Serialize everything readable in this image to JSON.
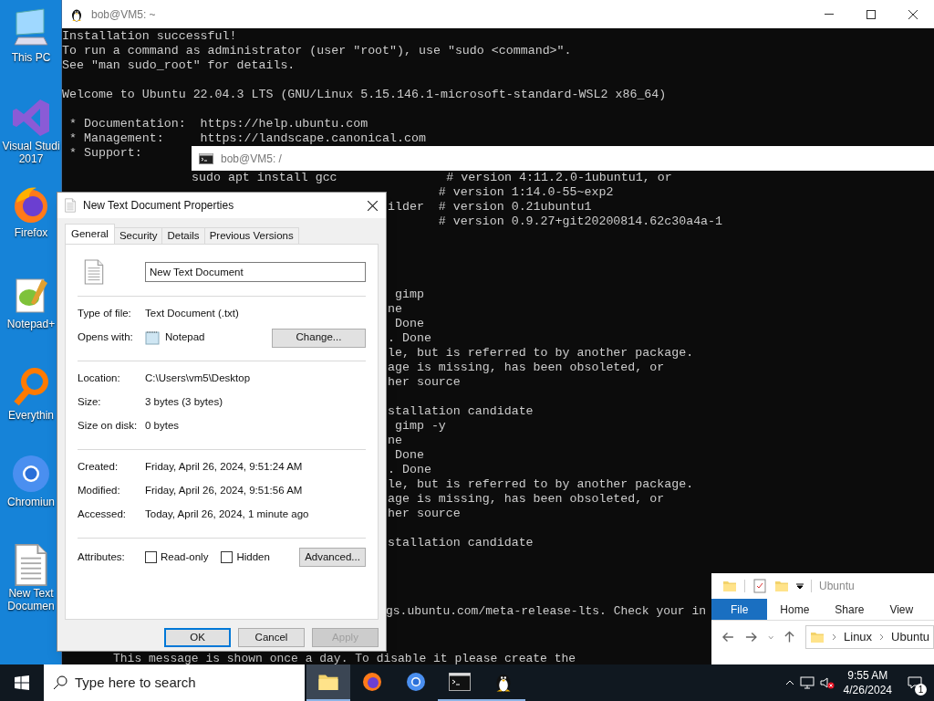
{
  "desktop_icons": [
    {
      "kind": "computer",
      "label": [
        "This PC"
      ]
    },
    {
      "kind": "studio",
      "label": [
        "Visual Studi",
        "2017"
      ]
    },
    {
      "kind": "firefox",
      "label": [
        "Firefox"
      ]
    },
    {
      "kind": "notepad",
      "label": [
        "Notepad+"
      ]
    },
    {
      "kind": "search",
      "label": [
        "Everythin"
      ]
    },
    {
      "kind": "chromium",
      "label": [
        "Chromiun"
      ]
    },
    {
      "kind": "textfile",
      "label": [
        "New Text",
        "Documen"
      ]
    }
  ],
  "terminal_main": {
    "title": "bob@VM5: ~",
    "blocks": [
      [
        "Installation successful!",
        "To run a command as administrator (user \"root\"), use \"sudo <command>\".",
        "See \"man sudo_root\" for details."
      ],
      [
        "Welcome to Ubuntu 22.04.3 LTS (GNU/Linux 5.15.146.1-microsoft-standard-WSL2 x86_64)"
      ],
      [
        " * Documentation:  https://help.ubuntu.com",
        " * Management:     https://landscape.canonical.com",
        " * Support:"
      ]
    ],
    "lower_lines": [
      "gs.ubuntu.com/meta-release-lts. Check your in",
      "This message is shown once a day. To disable it please create the"
    ]
  },
  "terminal_second": {
    "title": "bob@VM5: /",
    "first_line": "sudo apt install gcc               # version 4:11.2.0-1ubuntu1, or",
    "blocks": [
      [
        "       # version 1:14.0-55~exp2",
        "ilder  # version 0.21ubuntu1",
        "       # version 0.9.27+git20200814.62c30a4a-1"
      ],
      [
        " gimp",
        "ne",
        " Done",
        ". Done",
        "le, but is referred to by another package.",
        "age is missing, has been obsoleted, or",
        "her source"
      ],
      [
        "stallation candidate",
        " gimp -y",
        "ne",
        " Done",
        ". Done",
        "le, but is referred to by another package.",
        "age is missing, has been obsoleted, or",
        "her source"
      ],
      [
        "stallation candidate"
      ]
    ]
  },
  "properties_dialog": {
    "title": "New Text Document Properties",
    "tabs": [
      {
        "label": "General",
        "selected": true
      },
      {
        "label": "Security",
        "selected": false
      },
      {
        "label": "Details",
        "selected": false
      },
      {
        "label": "Previous Versions",
        "selected": false
      }
    ],
    "file_name": "New Text Document",
    "groups": [
      [
        {
          "label": "Type of file:",
          "value": "Text Document (.txt)"
        },
        {
          "label": "Opens with:",
          "value": "Notepad",
          "button": "Change..."
        }
      ],
      [
        {
          "label": "Location:",
          "value": "C:\\Users\\vm5\\Desktop"
        },
        {
          "label": "Size:",
          "value": "3 bytes (3 bytes)"
        },
        {
          "label": "Size on disk:",
          "value": "0 bytes"
        }
      ],
      [
        {
          "label": "Created:",
          "value": "Friday, April 26, 2024, 9:51:24 AM"
        },
        {
          "label": "Modified:",
          "value": "Friday, April 26, 2024, 9:51:56 AM"
        },
        {
          "label": "Accessed:",
          "value": "Today, April 26, 2024, 1 minute ago"
        }
      ]
    ],
    "attributes_label": "Attributes:",
    "attributes": [
      {
        "label": "Read-only",
        "checked": false
      },
      {
        "label": "Hidden",
        "checked": false
      }
    ],
    "advanced_button": "Advanced...",
    "buttons": [
      {
        "label": "OK",
        "default": true,
        "disabled": false
      },
      {
        "label": "Cancel",
        "default": false,
        "disabled": false
      },
      {
        "label": "Apply",
        "default": false,
        "disabled": true
      }
    ]
  },
  "explorer": {
    "title": "Ubuntu",
    "ribbon_tabs": [
      {
        "label": "File",
        "selected": true
      },
      {
        "label": "Home",
        "selected": false
      },
      {
        "label": "Share",
        "selected": false
      },
      {
        "label": "View",
        "selected": false
      }
    ],
    "path": [
      "Linux",
      "Ubuntu"
    ]
  },
  "taskbar": {
    "search_placeholder": "Type here to search",
    "apps": [
      {
        "kind": "folder",
        "running": true,
        "selected": true
      },
      {
        "kind": "firefox",
        "running": false,
        "selected": false
      },
      {
        "kind": "chromium",
        "running": false,
        "selected": false
      },
      {
        "kind": "terminal",
        "running": true,
        "selected": false
      },
      {
        "kind": "penguin",
        "running": true,
        "selected": false
      }
    ],
    "time": "9:55 AM",
    "date": "4/26/2024",
    "notifications": "1"
  }
}
